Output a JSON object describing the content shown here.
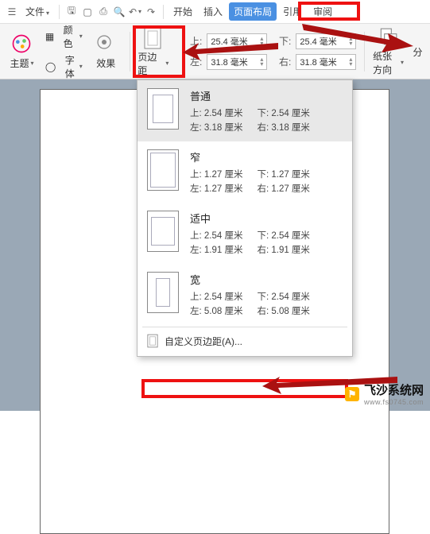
{
  "menubar": {
    "file": "文件",
    "tabs": {
      "start": "开始",
      "insert": "插入",
      "layout": "页面布局",
      "reference": "引用",
      "review": "审阅"
    }
  },
  "ribbon": {
    "theme": "主题",
    "color": "颜色",
    "font": "字体",
    "effect": "效果",
    "margin": "页边距",
    "orientation": "纸张方向",
    "break": "分",
    "margins": {
      "top_label": "上:",
      "top_value": "25.4 毫米",
      "bottom_label": "下:",
      "bottom_value": "25.4 毫米",
      "left_label": "左:",
      "left_value": "31.8 毫米",
      "right_label": "右:",
      "right_value": "31.8 毫米"
    }
  },
  "dropdown": {
    "items": [
      {
        "name": "普通",
        "top": "上: 2.54 厘米",
        "bottom": "下: 2.54 厘米",
        "left": "左: 3.18 厘米",
        "right": "右: 3.18 厘米"
      },
      {
        "name": "窄",
        "top": "上: 1.27 厘米",
        "bottom": "下: 1.27 厘米",
        "left": "左: 1.27 厘米",
        "right": "右: 1.27 厘米"
      },
      {
        "name": "适中",
        "top": "上: 2.54 厘米",
        "bottom": "下: 2.54 厘米",
        "left": "左: 1.91 厘米",
        "right": "右: 1.91 厘米"
      },
      {
        "name": "宽",
        "top": "上: 2.54 厘米",
        "bottom": "下: 2.54 厘米",
        "left": "左: 5.08 厘米",
        "right": "右: 5.08 厘米"
      }
    ],
    "custom": "自定义页边距(A)..."
  },
  "watermark": {
    "brand": "飞沙系统网",
    "url": "www.fs0745.com"
  }
}
